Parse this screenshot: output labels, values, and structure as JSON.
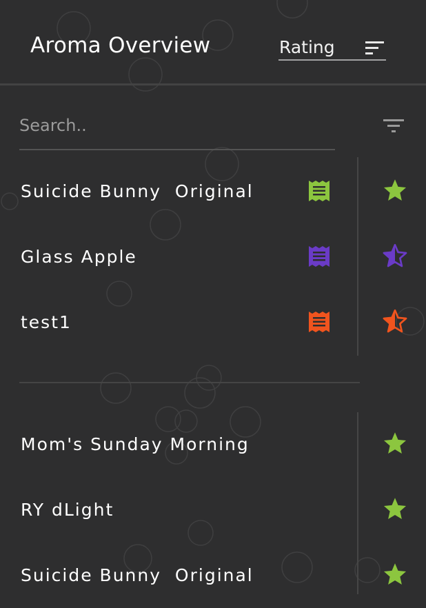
{
  "header": {
    "title": "Aroma Overview",
    "sort_label": "Rating",
    "sort_icon": "sort-lines-icon"
  },
  "search": {
    "placeholder": "Search..",
    "value": "",
    "filter_icon": "filter-icon"
  },
  "groups": [
    {
      "items": [
        {
          "name": "Suicide Bunny  Original",
          "note_icon": "note-icon",
          "note_color": "#8cc63f",
          "rating_icon": "star-full-icon",
          "star_color": "#8cc63f"
        },
        {
          "name": "Glass Apple",
          "note_icon": "note-icon",
          "note_color": "#6a3bc7",
          "rating_icon": "star-half-icon",
          "star_color": "#6a3bc7"
        },
        {
          "name": "test1",
          "note_icon": "note-icon",
          "note_color": "#f0541e",
          "rating_icon": "star-half-icon",
          "star_color": "#f0541e"
        }
      ]
    },
    {
      "items": [
        {
          "name": "Mom's Sunday Morning",
          "rating_icon": "star-full-icon",
          "star_color": "#8cc63f"
        },
        {
          "name": "RY dLight",
          "rating_icon": "star-full-icon",
          "star_color": "#8cc63f"
        },
        {
          "name": "Suicide Bunny  Original",
          "rating_icon": "star-full-icon",
          "star_color": "#8cc63f"
        }
      ]
    }
  ],
  "colors": {
    "background": "#2e2e2f",
    "text": "#ffffff",
    "divider": "#454545"
  }
}
